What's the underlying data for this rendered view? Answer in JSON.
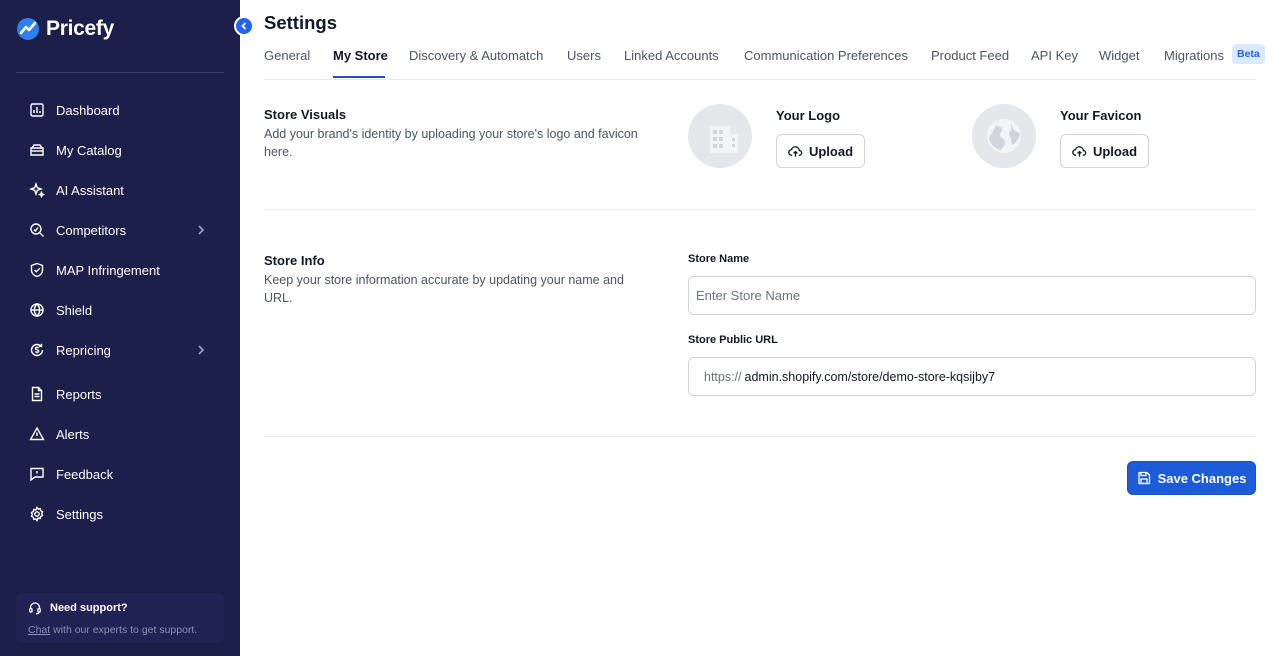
{
  "brand": {
    "name": "Pricefy"
  },
  "sidebar": {
    "items": [
      {
        "label": "Dashboard",
        "icon": "dashboard-icon"
      },
      {
        "label": "My Catalog",
        "icon": "catalog-icon"
      },
      {
        "label": "AI Assistant",
        "icon": "sparkle-icon"
      },
      {
        "label": "Competitors",
        "icon": "competitors-icon",
        "has_submenu": true
      },
      {
        "label": "MAP Infringement",
        "icon": "shield-check-icon"
      },
      {
        "label": "Shield",
        "icon": "globe-icon"
      },
      {
        "label": "Repricing",
        "icon": "dollar-cycle-icon",
        "has_submenu": true
      },
      {
        "label": "Reports",
        "icon": "report-icon"
      },
      {
        "label": "Alerts",
        "icon": "alert-icon"
      },
      {
        "label": "Feedback",
        "icon": "feedback-icon"
      },
      {
        "label": "Settings",
        "icon": "gear-icon"
      }
    ],
    "support": {
      "title": "Need support?",
      "link": "Chat",
      "text": "with our experts to get support."
    }
  },
  "page": {
    "title": "Settings",
    "tabs": [
      {
        "label": "General"
      },
      {
        "label": "My Store",
        "active": true
      },
      {
        "label": "Discovery & Automatch"
      },
      {
        "label": "Users"
      },
      {
        "label": "Linked Accounts"
      },
      {
        "label": "Communication Preferences"
      },
      {
        "label": "Product Feed"
      },
      {
        "label": "API Key"
      },
      {
        "label": "Widget"
      },
      {
        "label": "Migrations",
        "badge": "Beta"
      }
    ]
  },
  "store_visuals": {
    "title": "Store Visuals",
    "description": "Add your brand's identity by uploading your store's logo and favicon here.",
    "logo": {
      "label": "Your Logo",
      "button": "Upload"
    },
    "favicon": {
      "label": "Your Favicon",
      "button": "Upload"
    }
  },
  "store_info": {
    "title": "Store Info",
    "description": "Keep your store information accurate by updating your name and URL.",
    "store_name": {
      "label": "Store Name",
      "placeholder": "Enter Store Name",
      "value": ""
    },
    "store_url": {
      "label": "Store Public URL",
      "prefix": "https://",
      "value": "admin.shopify.com/store/demo-store-kqsijby7"
    }
  },
  "actions": {
    "save_label": "Save Changes"
  },
  "colors": {
    "sidebar_bg": "#1c1f4a",
    "accent": "#1d5bd8",
    "beta_bg": "#dbeafe"
  }
}
